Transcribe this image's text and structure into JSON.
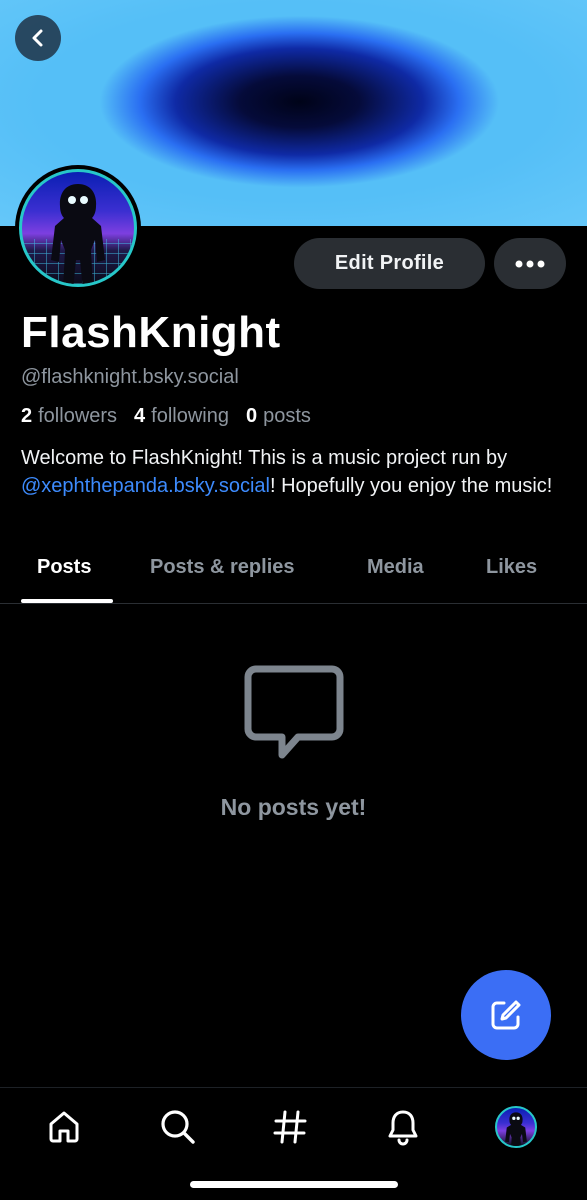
{
  "profile": {
    "display_name": "FlashKnight",
    "handle": "@flashknight.bsky.social",
    "followers_count": "2",
    "followers_label": "followers",
    "following_count": "4",
    "following_label": "following",
    "posts_count": "0",
    "posts_label": "posts",
    "bio_before": "Welcome to FlashKnight! This is a music project run by ",
    "bio_mention": "@xephthepanda.bsky.social",
    "bio_after": "! Hopefully you enjoy the music!"
  },
  "actions": {
    "edit_profile_label": "Edit Profile"
  },
  "tabs": [
    {
      "label": "Posts",
      "active": true
    },
    {
      "label": "Posts & replies",
      "active": false
    },
    {
      "label": "Media",
      "active": false
    },
    {
      "label": "Likes",
      "active": false
    }
  ],
  "empty_state": {
    "message": "No posts yet!",
    "icon": "message-square-icon"
  },
  "nav": {
    "items": [
      "home-icon",
      "search-icon",
      "hashtag-icon",
      "bell-icon",
      "profile-avatar"
    ]
  },
  "colors": {
    "background": "#000000",
    "accent": "#3b6ef5",
    "mention": "#3d8bfd",
    "muted_text": "#8e969f",
    "button_bg": "#2a2e33",
    "avatar_ring": "#27c7c9"
  }
}
